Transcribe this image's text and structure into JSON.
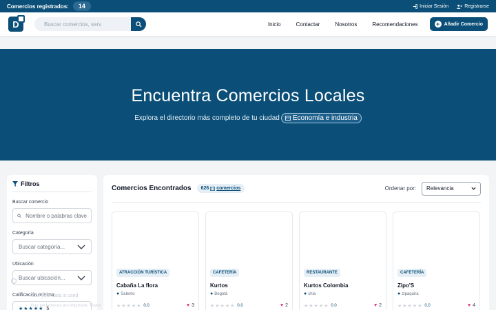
{
  "topbar": {
    "registered_label": "Comercios registrados:",
    "registered_count": "14",
    "login_label": "Iniciar Sesión",
    "register_label": "Registrarse"
  },
  "navbar": {
    "logo_letter": "D",
    "search_placeholder": "Buscar comercios, serv",
    "links": [
      "Inicio",
      "Contactar",
      "Nosotros",
      "Recomendaciones"
    ],
    "add_button_label": "Añadir Comercio"
  },
  "hero": {
    "title": "Encuentra Comercios Locales",
    "subtitle": "Explora el directorio más completo de tu ciudad",
    "pill_label": "Economía e industria"
  },
  "filters": {
    "title": "Filtros",
    "search_label": "Buscar comercio",
    "search_placeholder": "Nombre o palabras clave",
    "category_label": "Categoría",
    "category_placeholder": "Buscar categoría...",
    "location_label": "Ubicación",
    "location_placeholder": "Buscar ubicación...",
    "rating_label": "Calificación mínima",
    "rating_value": "5",
    "ghost_text_1": "Now your data is used",
    "ghost_text_2": "Your preferences are important. Thank"
  },
  "results": {
    "title": "Comercios Encontrados",
    "count": "626",
    "count_label": "comercios",
    "sort_label": "Ordenar por:",
    "sort_value": "Relevancia",
    "cards": [
      {
        "category": "Atracción Turística",
        "name": "Cabaña La flora",
        "location": "Salento",
        "rating": "0.0",
        "favorites": "3"
      },
      {
        "category": "Cafetería",
        "name": "Kurtos",
        "location": "Bogotá",
        "rating": "0.0",
        "favorites": "2"
      },
      {
        "category": "Restaurante",
        "name": "Kurtos Colombia",
        "location": "chia",
        "rating": "0.0",
        "favorites": "2"
      },
      {
        "category": "Cafetería",
        "name": "Zipo'S",
        "location": "zipaquira",
        "rating": "0.0",
        "favorites": "4"
      }
    ]
  },
  "colors": {
    "brand": "#0b4f78",
    "accent_badge": "#e6eff6",
    "heart": "#db2777"
  }
}
